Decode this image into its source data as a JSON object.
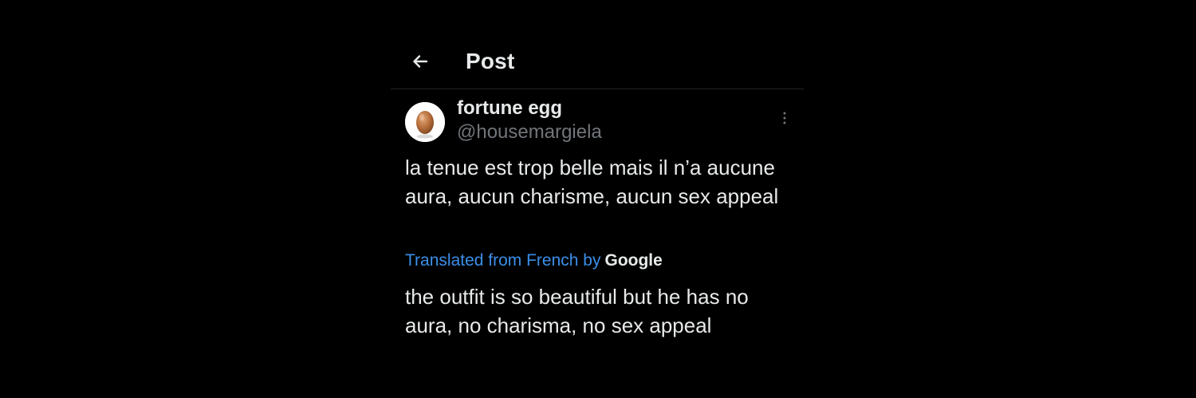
{
  "header": {
    "back_icon": "arrow-left-icon",
    "title": "Post"
  },
  "post": {
    "author": {
      "display_name": "fortune egg",
      "handle": "@housemargiela",
      "avatar_icon": "egg-avatar"
    },
    "more_icon": "more-vertical-icon",
    "original_text": "la tenue est trop belle mais il n’a aucune aura, aucun charisme, aucun sex appeal",
    "translation": {
      "label": "Translated from French by",
      "provider": "Google",
      "text": "the outfit is so beautiful but he has no aura, no charisma, no sex appeal"
    }
  },
  "colors": {
    "background": "#000000",
    "text_primary": "#e7e9ea",
    "text_secondary": "#71767b",
    "link_blue": "#3b8ee8",
    "divider": "#1f2226"
  }
}
